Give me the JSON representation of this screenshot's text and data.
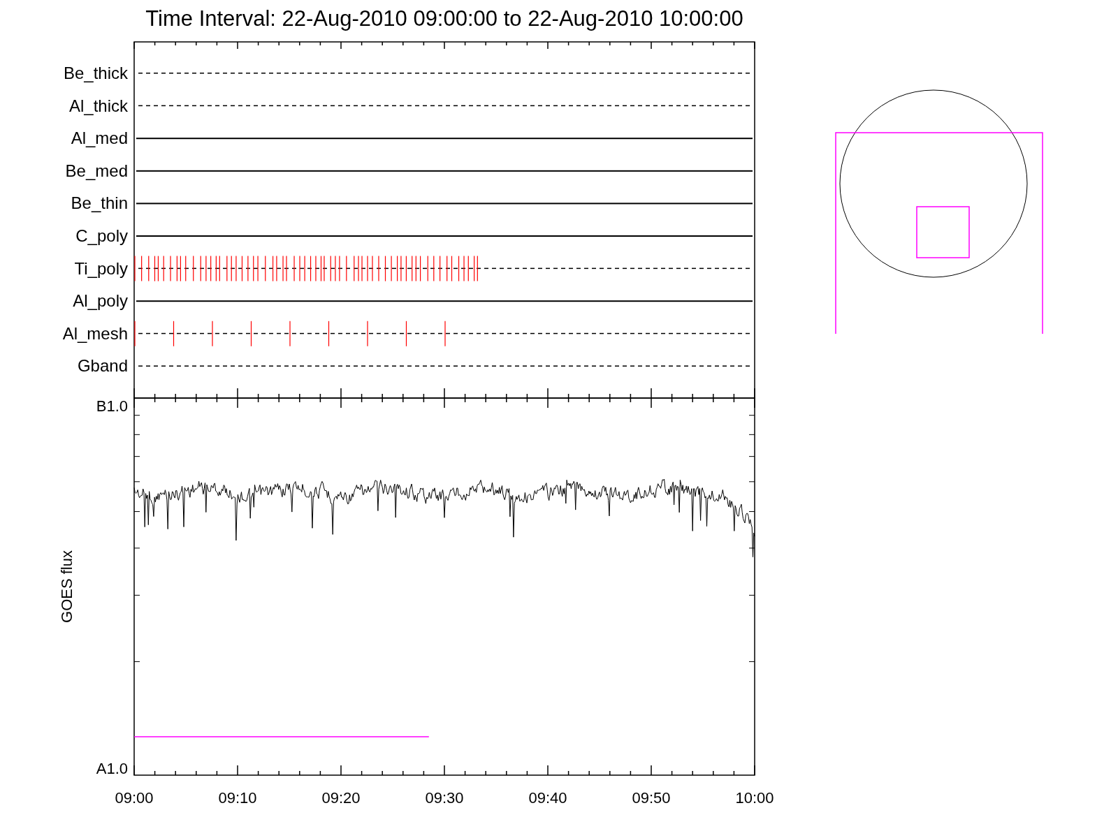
{
  "title": "Time Interval: 22-Aug-2010 09:00:00 to 22-Aug-2010 10:00:00",
  "filters": [
    {
      "label": "Be_thick",
      "dashed": true,
      "kind": "plain"
    },
    {
      "label": "Al_thick",
      "dashed": true,
      "kind": "plain"
    },
    {
      "label": "Al_med",
      "dashed": false,
      "kind": "plain"
    },
    {
      "label": "Be_med",
      "dashed": false,
      "kind": "plain"
    },
    {
      "label": "Be_thin",
      "dashed": false,
      "kind": "plain"
    },
    {
      "label": "C_poly",
      "dashed": false,
      "kind": "plain"
    },
    {
      "label": "Ti_poly",
      "dashed": true,
      "kind": "dense"
    },
    {
      "label": "Al_poly",
      "dashed": false,
      "kind": "plain"
    },
    {
      "label": "Al_mesh",
      "dashed": true,
      "kind": "sparse"
    },
    {
      "label": "Gband",
      "dashed": true,
      "kind": "plain"
    }
  ],
  "flux_panel": {
    "ylabel": "GOES flux",
    "y_tick_labels": [
      "B1.0",
      "A1.0"
    ],
    "x_tick_labels": [
      "09:00",
      "09:10",
      "09:20",
      "09:30",
      "09:40",
      "09:50",
      "10:00"
    ]
  }
}
